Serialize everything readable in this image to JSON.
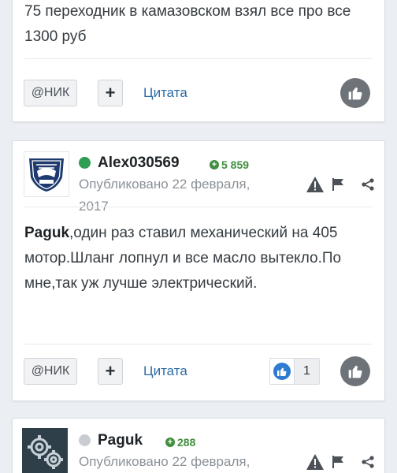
{
  "post1": {
    "text": "75 переходник в камазовском взял все про все 1300 руб",
    "nick_button": "@НИК",
    "plus_button": "+",
    "quote_link": "Цитата"
  },
  "post2": {
    "author": "Alex030569",
    "reputation": "5 859",
    "published": "Опубликовано 22 февраля, 2017",
    "mention": "Paguk",
    "text": ",один раз ставил механический на 405 мотор.Шланг лопнул и все масло вытекло.По мне,так уж лучше электрический.",
    "nick_button": "@НИК",
    "plus_button": "+",
    "quote_link": "Цитата",
    "like_count": "1",
    "status_color": "#2e9d55"
  },
  "post3": {
    "author": "Paguk",
    "reputation": "288",
    "published": "Опубликовано 22 февраля,",
    "status_color": "#c9cdd1"
  },
  "icons": {
    "report": "warning-icon",
    "flag": "flag-icon",
    "share": "share-icon",
    "like": "thumbs-up-icon"
  },
  "colors": {
    "link": "#2a6aa6",
    "reputation": "#3f8f3f",
    "like_button": "#6d7378",
    "reaction_like": "#2e7bd1"
  }
}
